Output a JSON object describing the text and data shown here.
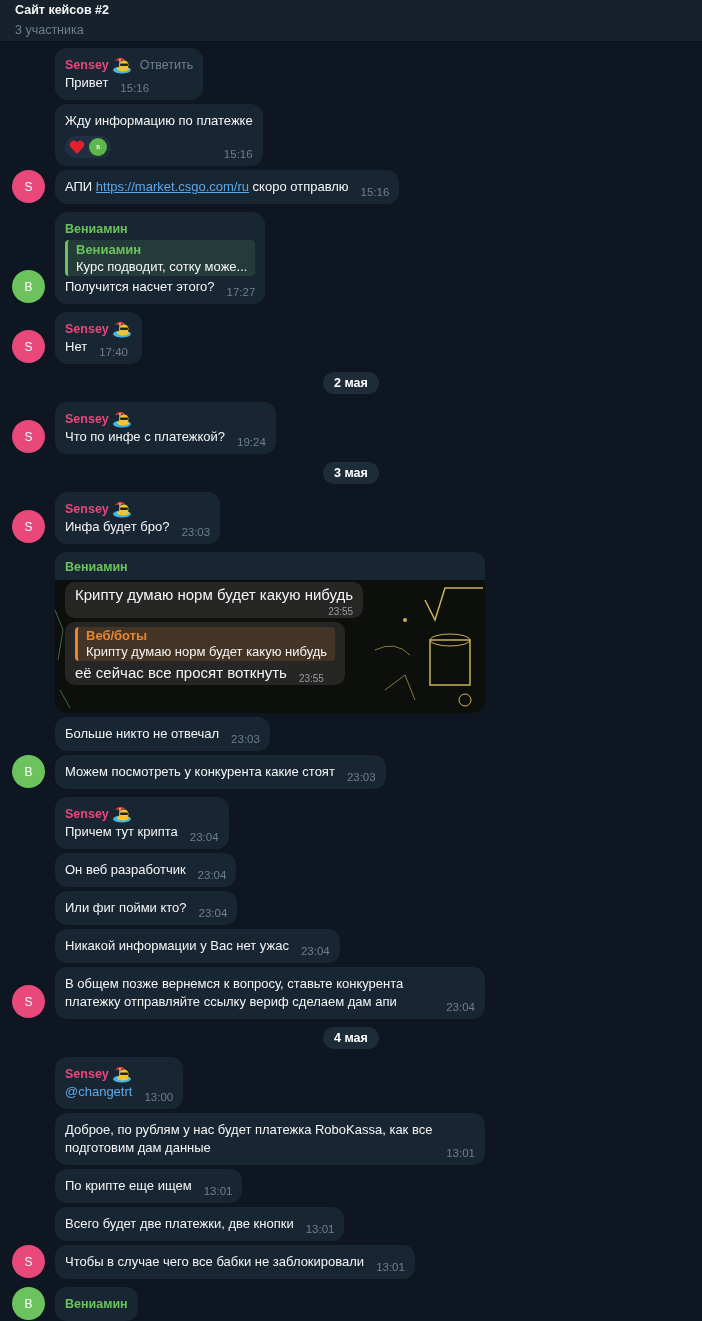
{
  "header": {
    "title": "Сайт кейсов #2",
    "subtitle": "3 участника"
  },
  "feed": [
    {
      "kind": "group",
      "initial": "S",
      "color": "#e8487a",
      "messages": [
        {
          "sender": "Sensey",
          "sticker": true,
          "reply_action": "Ответить",
          "text": "Привет",
          "time": "15:16"
        },
        {
          "text": "Жду информацию по платежке",
          "time": "15:16",
          "reaction": {
            "avatar": "в"
          }
        },
        {
          "text": "АПИ ",
          "link": "https://market.csgo.com/ru",
          "text_after": " скоро отправлю",
          "time": "15:16"
        }
      ]
    },
    {
      "kind": "group",
      "initial": "В",
      "color": "#6cc35d",
      "messages": [
        {
          "sender": "Вениамин",
          "quote": {
            "name": "Вениамин",
            "text": "Курс подводит, сотку може...",
            "color": "#6cc35d"
          },
          "text": "Получится насчет этого?",
          "time": "17:27"
        }
      ]
    },
    {
      "kind": "group",
      "initial": "S",
      "color": "#e8487a",
      "messages": [
        {
          "sender": "Sensey",
          "sticker": true,
          "text": "Нет",
          "time": "17:40"
        }
      ]
    },
    {
      "kind": "date",
      "text": "2 мая"
    },
    {
      "kind": "group",
      "initial": "S",
      "color": "#e8487a",
      "messages": [
        {
          "sender": "Sensey",
          "sticker": true,
          "text": "Что по инфе с платежкой?",
          "time": "19:24"
        }
      ]
    },
    {
      "kind": "date",
      "text": "3 мая"
    },
    {
      "kind": "group",
      "initial": "S",
      "color": "#e8487a",
      "messages": [
        {
          "sender": "Sensey",
          "sticker": true,
          "text": "Инфа будет бро?",
          "time": "23:03"
        }
      ]
    },
    {
      "kind": "group",
      "initial": "В",
      "color": "#6cc35d",
      "messages": [
        {
          "sender": "Вениамин",
          "kind": "screenshot",
          "inner": [
            {
              "text": "Крипту думаю норм будет какую нибудь",
              "time": "23:55"
            },
            {
              "quote": {
                "name": "Веб/боты",
                "text": "Крипту думаю норм будет какую нибудь",
                "color": "#e8872f"
              },
              "text": "её сейчас все просят воткнуть",
              "time": "23:55"
            }
          ]
        },
        {
          "text": "Больше никто не отвечал",
          "time": "23:03"
        },
        {
          "text": "Можем посмотреть у конкурента какие стоят",
          "time": "23:03"
        }
      ]
    },
    {
      "kind": "group",
      "initial": "S",
      "color": "#e8487a",
      "messages": [
        {
          "sender": "Sensey",
          "sticker": true,
          "text": "Причем тут крипта",
          "time": "23:04"
        },
        {
          "text": "Он веб разработчик",
          "time": "23:04"
        },
        {
          "text": "Или фиг пойми кто?",
          "time": "23:04"
        },
        {
          "text": "Никакой информации у Вас нет ужас",
          "time": "23:04"
        },
        {
          "text": "В общем позже вернемся к вопросу, ставьте конкурента платежку отправляйте ссылку вериф сделаем дам апи",
          "time": "23:04"
        }
      ]
    },
    {
      "kind": "date",
      "text": "4 мая"
    },
    {
      "kind": "group",
      "initial": "S",
      "color": "#e8487a",
      "messages": [
        {
          "sender": "Sensey",
          "sticker": true,
          "mention": "@changetrt",
          "time": "13:00"
        },
        {
          "text": "Доброе, по рублям у нас будет платежка RoboKassa, как все подготовим дам данные",
          "time": "13:01"
        },
        {
          "text": "По крипте еще ищем",
          "time": "13:01"
        },
        {
          "text": "Всего будет две платежки, две кнопки",
          "time": "13:01"
        },
        {
          "text": "Чтобы в случае чего все бабки не заблокировали",
          "time": "13:01"
        }
      ]
    },
    {
      "kind": "group",
      "initial": "В",
      "color": "#6cc35d",
      "messages": [
        {
          "sender": "Вениамин"
        }
      ]
    }
  ]
}
